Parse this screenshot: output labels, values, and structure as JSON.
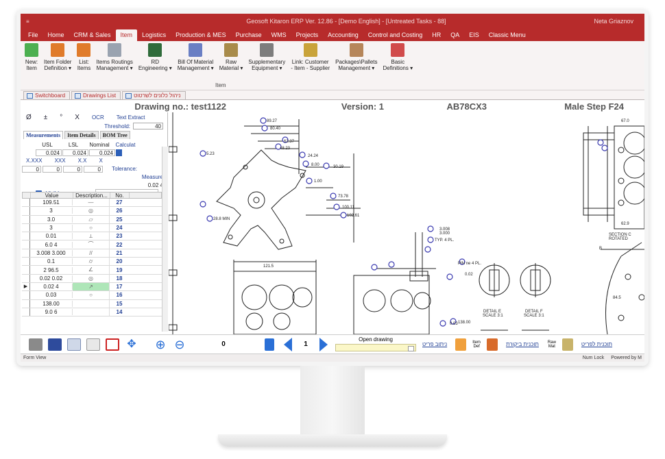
{
  "title_bar": {
    "quick_access": "≡",
    "title": "Geosoft Kitaron ERP Ver. 12.86 - [Demo English] - [Untreated Tasks - 88]",
    "user": "Neta Griaznov"
  },
  "menu": [
    "File",
    "Home",
    "CRM & Sales",
    "Item",
    "Logistics",
    "Production & MES",
    "Purchase",
    "WMS",
    "Projects",
    "Accounting",
    "Control and Costing",
    "HR",
    "QA",
    "EIS",
    "Classic Menu"
  ],
  "menu_active": "Item",
  "ribbon": {
    "buttons": [
      {
        "label": "New:\nItem",
        "icon": "new-item-icon"
      },
      {
        "label": "Item Folder\nDefinition ▾",
        "icon": "item-folder-icon"
      },
      {
        "label": "List:\nItems",
        "icon": "list-items-icon"
      },
      {
        "label": "Items Routings\nManagement ▾",
        "icon": "routings-icon"
      },
      {
        "label": "RD\nEngineering ▾",
        "icon": "rd-engineering-icon"
      },
      {
        "label": "Bill Of Material\nManagement ▾",
        "icon": "bom-icon"
      },
      {
        "label": "Raw\nMaterial ▾",
        "icon": "raw-material-icon"
      },
      {
        "label": "Supplementary\nEquipment ▾",
        "icon": "equipment-icon"
      },
      {
        "label": "Link: Customer\n- Item - Supplier",
        "icon": "link-icon"
      },
      {
        "label": "Packages\\Pallets\nManagement ▾",
        "icon": "packages-icon"
      },
      {
        "label": "Basic\nDefinitions ▾",
        "icon": "basic-definitions-icon"
      }
    ],
    "group_label": "Item"
  },
  "tabs": [
    "Switchboard",
    "Drawings List",
    "ניהול כלונים לשרטוט"
  ],
  "form_header": {
    "drawing": "Drawing no.: test1122",
    "version": "Version: 1",
    "code": "AB78CX3",
    "name": "Male Step F24"
  },
  "left_panel": {
    "top_symbols": [
      "Ø",
      "±",
      "°",
      "X"
    ],
    "ocr_label": "OCR",
    "text_extract_label": "Text Extract",
    "threshold_label": "Threshold:",
    "threshold_value": "40",
    "subtabs": [
      "Measurements",
      "Item Details",
      "BOM Tree"
    ],
    "usl_label": "USL",
    "lsl_label": "LSL",
    "nominal_label": "Nominal",
    "calc_label": "Calculat",
    "usl": "0.024",
    "lsl": "0.024",
    "nominal": "0.024",
    "formats": [
      "X.XXX",
      "XXX",
      "X.X",
      "X"
    ],
    "zeros": [
      "0",
      "0",
      "0",
      "0"
    ],
    "tolerance_label": "Tolerance:",
    "measure_label": "Measure",
    "measure_value": "0.02 4",
    "visible_label": "Visible:",
    "columns": [
      "Value",
      "Description...",
      "No."
    ],
    "rows": [
      {
        "value": "109.51",
        "desc": "—",
        "no": "27"
      },
      {
        "value": "3",
        "desc": "◎",
        "no": "26"
      },
      {
        "value": "3.0",
        "desc": "▱",
        "no": "25"
      },
      {
        "value": "3",
        "desc": "○",
        "no": "24"
      },
      {
        "value": "0.01",
        "desc": "⟂",
        "no": "23"
      },
      {
        "value": "6.0 4",
        "desc": "⌒",
        "no": "22"
      },
      {
        "value": "3.008 3.000",
        "desc": "//",
        "no": "21"
      },
      {
        "value": "0.1",
        "desc": "⌭",
        "no": "20"
      },
      {
        "value": "2 96.5",
        "desc": "∠",
        "no": "19"
      },
      {
        "value": "0.02 0.02",
        "desc": "◎",
        "no": "18"
      },
      {
        "value": "0.02 4",
        "desc": "↗",
        "no": "17",
        "selected": true
      },
      {
        "value": "0.03",
        "desc": "○",
        "no": "16"
      },
      {
        "value": "138.00",
        "desc": "",
        "no": "15"
      },
      {
        "value": "9.0 6",
        "desc": "",
        "no": "14"
      }
    ]
  },
  "drawing_labels": [
    "89.27",
    "80.40",
    "62.37",
    "48.23",
    "24.24",
    "8.00",
    "30.19",
    "5.23",
    "1.00",
    "73.78",
    "100.11",
    "102.61",
    "28.8 MIN",
    "121.5",
    "3.008",
    "3.000",
    "TYP. 4 PL.",
    "DETAIL E",
    "SCALE 3:1",
    "DETAIL F",
    "SCALE 3:1",
    "SECTION C",
    "ROTATED",
    "B",
    "84.5",
    "67.0",
    "62.9",
    "PIN ne 4 PL.",
    "0.02",
    "138.00",
    "0.03"
  ],
  "bottom_toolbar": {
    "page_value": "0",
    "current_page": "1",
    "open_drawing_label": "Open drawing",
    "links": [
      "ניתוב פריט",
      "תוכנית ביקורת",
      "תוכנית לפריט"
    ],
    "item_def_label": "Item Def",
    "raw_mat_label": "Raw Mat"
  },
  "status_bar": {
    "left": "Form View",
    "num_lock": "Num Lock",
    "powered": "Powered by M"
  },
  "colors": {
    "brand": "#b72b2b",
    "link": "#1f3e93",
    "highlight": "#aee6b8"
  }
}
